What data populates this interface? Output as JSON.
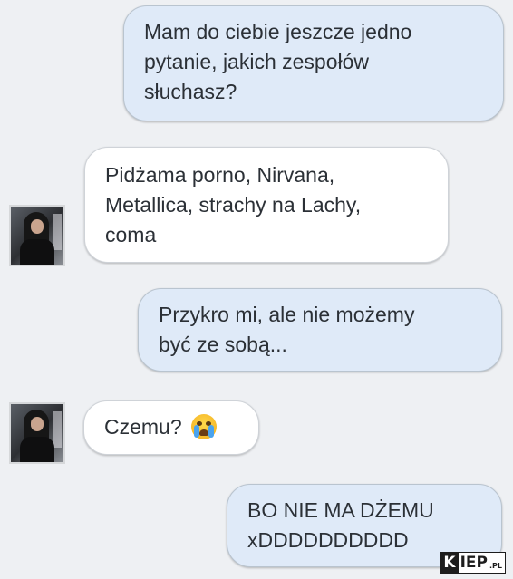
{
  "messages": [
    {
      "side": "outgoing",
      "text_lines": [
        "Mam do ciebie jeszcze jedno",
        "pytanie, jakich zespołów",
        "słuchasz?"
      ]
    },
    {
      "side": "incoming",
      "text_lines": [
        "Pidżama porno, Nirvana,",
        "Metallica, strachy na Lachy,",
        "coma"
      ]
    },
    {
      "side": "outgoing",
      "text_lines": [
        "Przykro mi, ale nie możemy",
        "być ze sobą..."
      ]
    },
    {
      "side": "incoming",
      "text": "Czemu?",
      "emoji": "crying-face-emoji"
    },
    {
      "side": "outgoing",
      "text_lines": [
        "BO NIE MA DŻEMU",
        "xDDDDDDDDDD"
      ]
    }
  ],
  "watermark": {
    "first": "K",
    "rest": "IEP",
    "suffix": ".PL"
  },
  "colors": {
    "outgoing_bubble": "#dfeaf8",
    "incoming_bubble": "#ffffff",
    "background": "#eef0f3"
  }
}
